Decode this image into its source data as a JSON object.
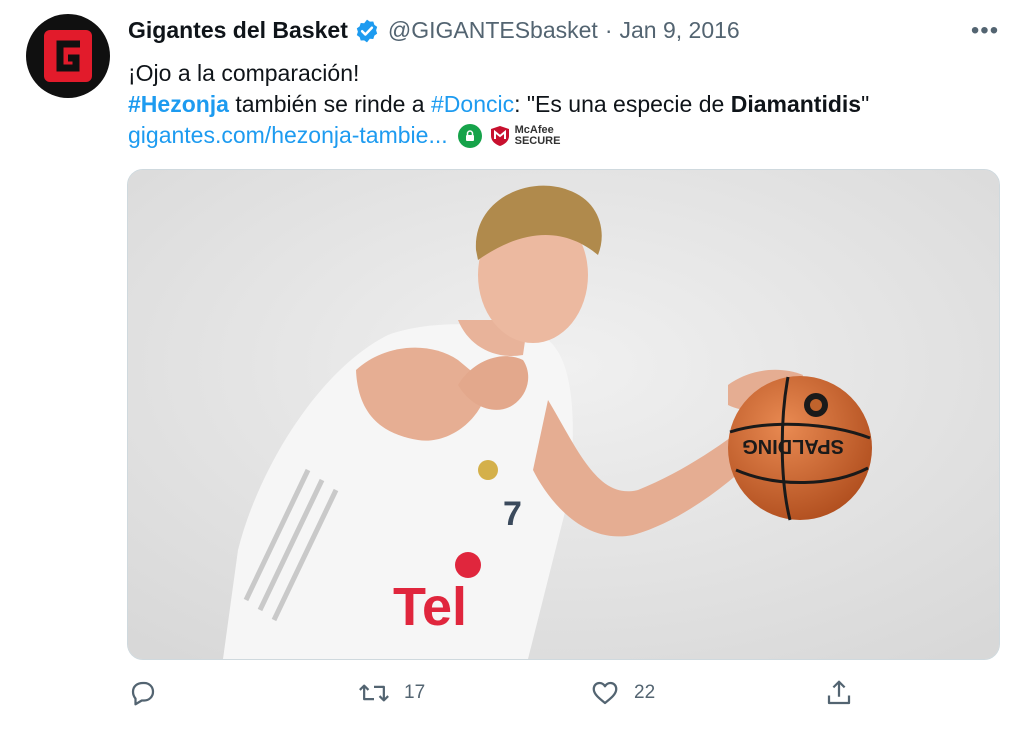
{
  "tweet": {
    "author_name": "Gigantes del Basket",
    "author_handle": "@GIGANTESbasket",
    "separator": "·",
    "date": "Jan 9, 2016",
    "more_label": "•••",
    "line1": "¡Ojo a la comparación!",
    "line2": {
      "hashtag1": "#Hezonja",
      "text1": " también se rinde a ",
      "hashtag2": "#Doncic",
      "text2": ": \"Es una especie de ",
      "bold": "Diamantidis",
      "text3": "\""
    },
    "link": "gigantes.com/hezonja-tambie...",
    "mcafee_line1": "McAfee",
    "mcafee_line2": "SECURE",
    "avatar_letter": "G",
    "image_alt": "Player in white jersey number 7 pointing forward while dribbling a basketball",
    "jersey_number": "7",
    "ball_brand": "SPALDING",
    "jersey_sponsor": "Tel"
  },
  "actions": {
    "reply_count": "",
    "retweet_count": "17",
    "like_count": "22"
  },
  "colors": {
    "accent": "#1d9bf0",
    "secondary_text": "#536471",
    "verified": "#1d9bf0",
    "avatar_red": "#e21b2b"
  },
  "icons": {
    "reply": "reply-icon",
    "retweet": "retweet-icon",
    "like": "heart-icon",
    "share": "share-icon",
    "verified": "verified-badge-icon",
    "lock": "lock-icon",
    "more": "more-icon"
  }
}
